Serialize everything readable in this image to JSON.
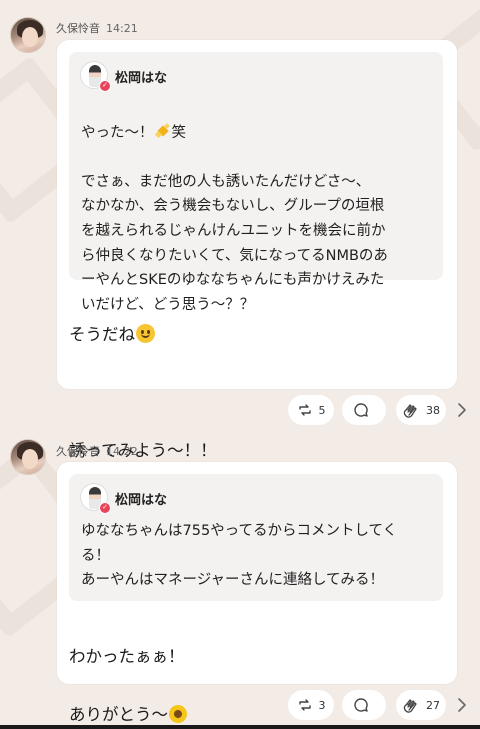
{
  "posts": [
    {
      "author": "久保怜音",
      "time": "14:21",
      "quote": {
        "name": "松岡はな",
        "line1_a": "やった〜！",
        "line1_b": "笑",
        "body": "でさぁ、まだ他の人も誘いたんだけどさ〜、\nなかなか、会う機会もないし、グループの垣根\nを越えられるじゃんけんユニットを機会に前か\nら仲良くなりたいくて、気になってるNMBのあ\nーやんとSKEのゆななちゃんにも声かけえみた\nいだけど、どう思う〜？？"
      },
      "reply_line1": "そうだね",
      "reply_line2": "誘ってみよう〜！！",
      "actions": {
        "repost_count": "5",
        "comment_count": "",
        "clap_count": "38"
      }
    },
    {
      "author": "久保怜音",
      "time": "14:22",
      "quote": {
        "name": "松岡はな",
        "body": "ゆななちゃんは755やってるからコメントしてく\nる！\nあーやんはマネージャーさんに連絡してみる！"
      },
      "reply_line1": "わかったぁぁ！",
      "reply_line2": "ありがとう〜",
      "actions": {
        "repost_count": "3",
        "comment_count": "",
        "clap_count": "27"
      }
    }
  ],
  "icons": {
    "repost": "repost-icon",
    "comment": "comment-icon",
    "clap": "clap-icon",
    "more": "chevron-right-icon",
    "verified": "verified-badge-icon",
    "emoji_smile": "smile-emoji",
    "emoji_sparkle": "sparkle-emoji",
    "emoji_sunflower": "sunflower-emoji"
  },
  "colors": {
    "background": "#f2ebe6",
    "bubble": "#ffffff",
    "quote_bg": "#f4f2f1",
    "verified": "#e8455b"
  }
}
